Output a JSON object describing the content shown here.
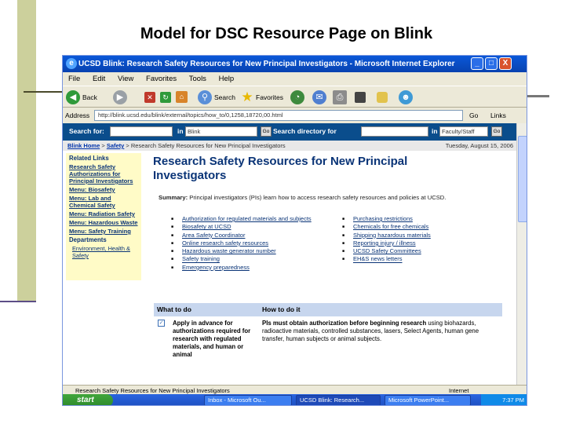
{
  "slide": {
    "title": "Model for DSC Resource Page on Blink"
  },
  "window": {
    "title": "UCSD Blink: Research Safety Resources for New Principal Investigators - Microsoft Internet Explorer",
    "icon_glyph": "e",
    "minimize": "_",
    "maximize": "□",
    "close": "X"
  },
  "menu": [
    "File",
    "Edit",
    "View",
    "Favorites",
    "Tools",
    "Help"
  ],
  "toolbar": {
    "back": "Back",
    "search": "Search",
    "favorites": "Favorites"
  },
  "address": {
    "label": "Address",
    "url": "http://blink.ucsd.edu/blink/external/topics/how_to/0,1258,18720,00.html",
    "links": "Links"
  },
  "searchbar": {
    "search_for_label": "Search for:",
    "in_label": "in",
    "scope": "Blink",
    "go": "Go",
    "directory_label": "Search directory for",
    "directory_in": "in",
    "directory_scope": "Faculty/Staff"
  },
  "breadcrumb": {
    "home": "Blink Home",
    "sep1": " > ",
    "safety": "Safety",
    "rest": " > Research Safety Resources for New Principal Investigators",
    "date": "Tuesday, August 15, 2006"
  },
  "sidenav": {
    "related_heading": "Related Links",
    "related_link": "Research Safety Authorizations for Principal Investigators",
    "menus": [
      "Menu: Biosafety",
      "Menu: Lab and Chemical Safety",
      "Menu: Radiation Safety",
      "Menu: Hazardous Waste",
      "Menu: Safety Training"
    ],
    "departments_heading": "Departments",
    "department_link": "Environment, Health & Safety"
  },
  "main": {
    "heading": "Research Safety Resources for New Principal Investigators",
    "summary_label": "Summary:",
    "summary_text": "Principal investigators (PIs) learn how to access research safety resources and policies at UCSD.",
    "col1": [
      "Authorization for regulated materials and subjects",
      "Biosafety at UCSD",
      "Area Safety Coordinator",
      "Online research safety resources",
      "Hazardous waste generator number",
      "Safety training",
      "Emergency preparedness"
    ],
    "col2": [
      "Purchasing restrictions",
      "Chemicals for free chemicals",
      "Shipping hazardous materials",
      "Reporting injury / illness",
      "UCSD Safety Committees",
      "EH&S news letters"
    ],
    "table": {
      "col1_head": "What to do",
      "col2_head": "How to do it",
      "check_glyph": "✓",
      "row1_what": "Apply in advance for authorizations required for research with regulated materials, and human or animal",
      "row1_how_bold": "PIs must obtain authorization before beginning research",
      "row1_how": " using biohazards, radioactive materials, controlled substances, lasers, Select Agents, human gene transfer, human subjects or animal subjects."
    }
  },
  "status": {
    "text": "Research Safety Resources for New Principal Investigators",
    "zone": "Internet"
  },
  "taskbar": {
    "start": "start",
    "tasks": [
      "Inbox - Microsoft Ou...",
      "UCSD Blink: Research...",
      "Microsoft PowerPoint..."
    ],
    "clock": "7:37 PM"
  }
}
